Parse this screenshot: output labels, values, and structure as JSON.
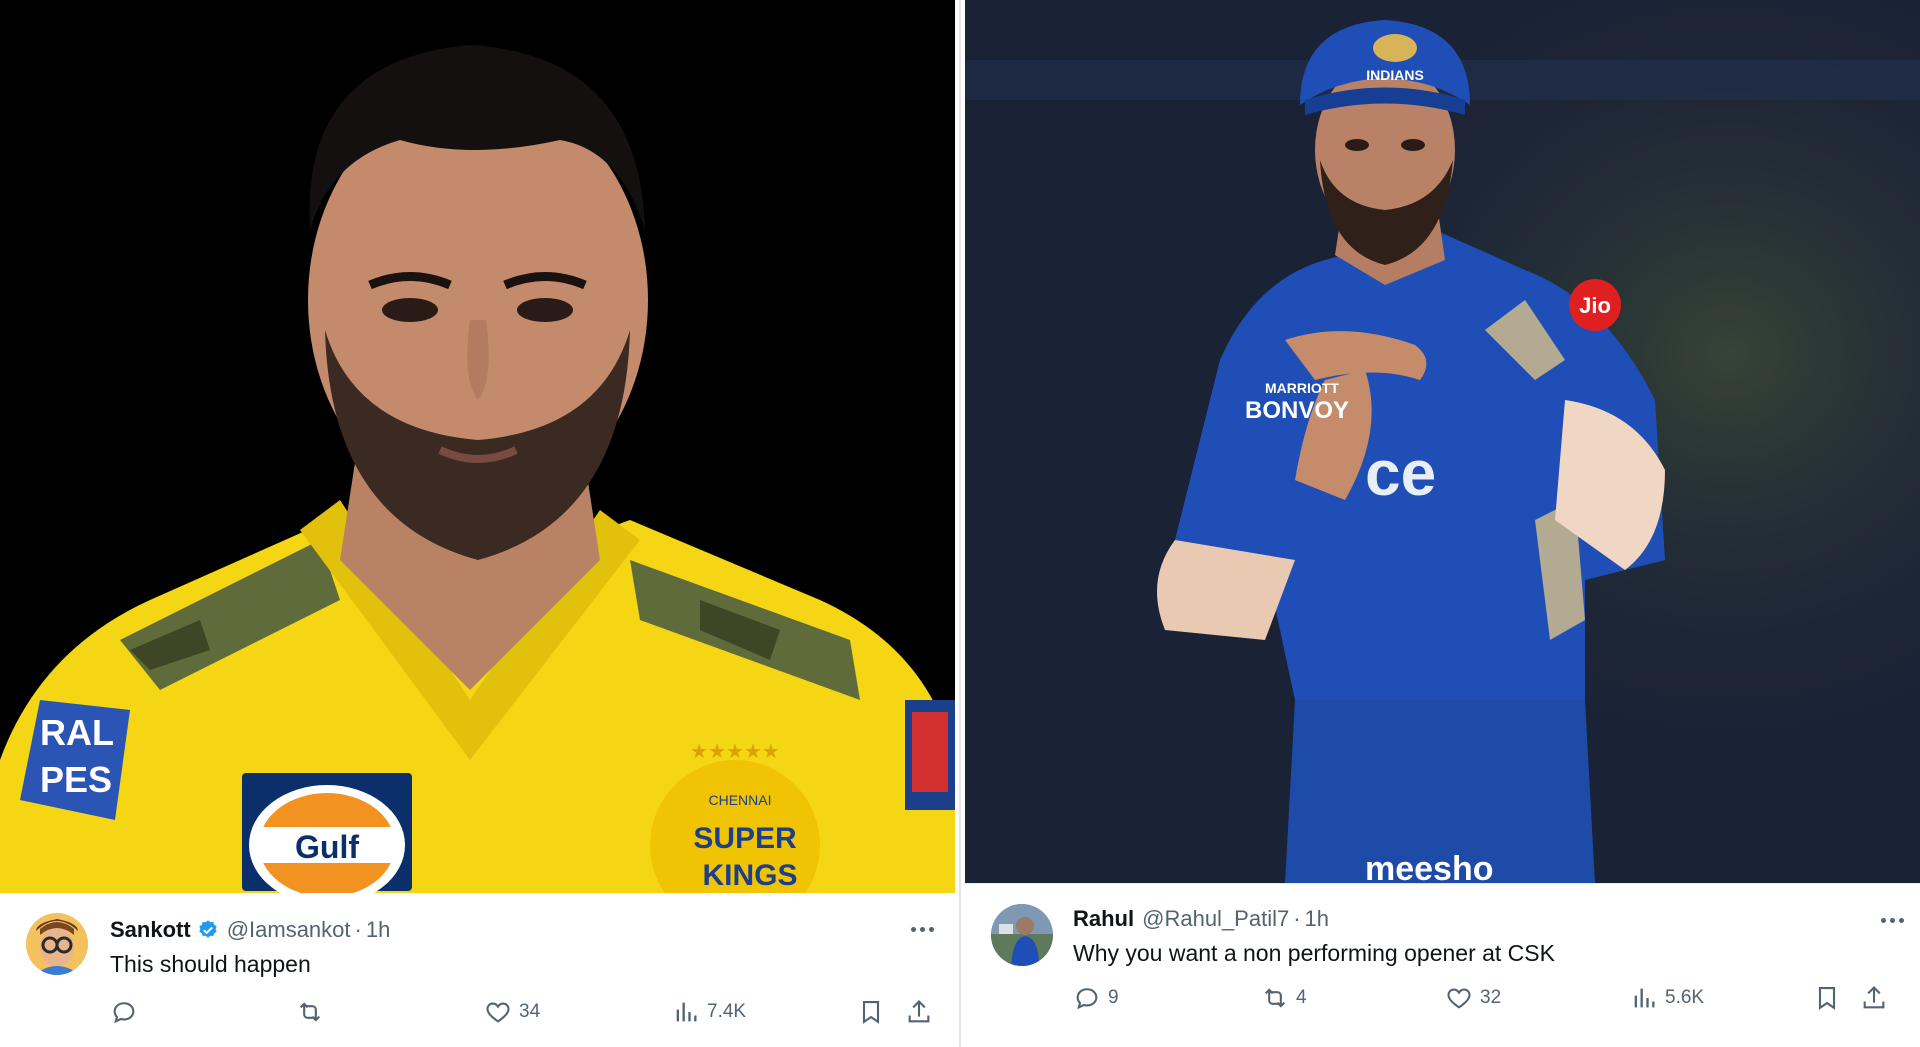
{
  "left_tweet": {
    "author_name": "Sankott",
    "handle": "@Iamsankot",
    "separator": "·",
    "time": "1h",
    "text": "This should happen",
    "verified": true,
    "stats": {
      "replies": "",
      "reposts": "",
      "likes": "34",
      "views": "7.4K"
    },
    "jersey_text": {
      "brand": "Gulf",
      "sleeve": "RAL\nPES",
      "crest_top": "CHENNAI",
      "crest_line1": "SUPER",
      "crest_line2": "KINGS"
    }
  },
  "right_tweet": {
    "author_name": "Rahul",
    "handle": "@Rahul_Patil7",
    "separator": "·",
    "time": "1h",
    "text": "Why you want a non performing opener at CSK",
    "verified": false,
    "stats": {
      "replies": "9",
      "reposts": "4",
      "likes": "32",
      "views": "5.6K"
    },
    "jersey_text": {
      "cap": "INDIANS",
      "chest": "ce",
      "sponsor_a": "MARRIOTT",
      "sponsor_b": "BONVOY",
      "sleeve_badge": "Jio",
      "shorts": "meesho"
    }
  },
  "colors": {
    "csk_yellow": "#f4d615",
    "mi_blue": "#1f4fb6",
    "verified_blue": "#1d9bf0",
    "text_primary": "#0f1419",
    "text_secondary": "#536471"
  },
  "icons": {
    "reply": "reply-icon",
    "repost": "repost-icon",
    "like": "heart-icon",
    "views": "views-icon",
    "bookmark": "bookmark-icon",
    "share": "share-icon",
    "more": "more-icon"
  }
}
